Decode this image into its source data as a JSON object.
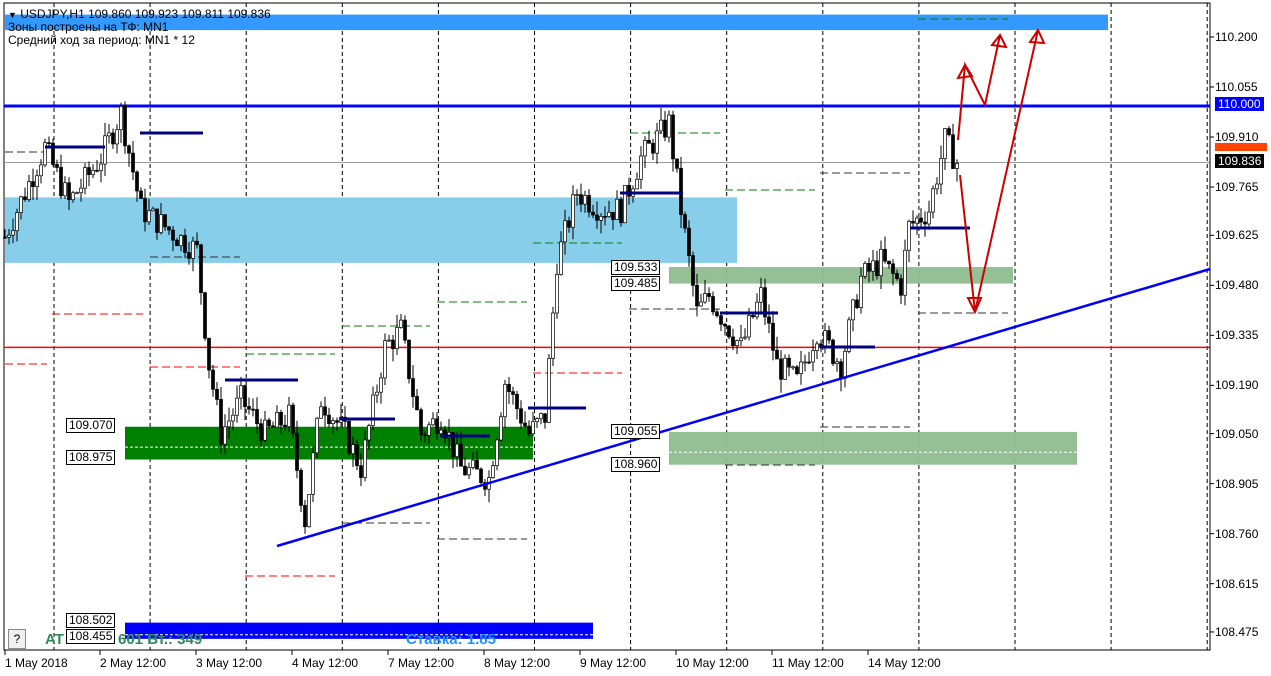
{
  "header": {
    "title": "USDJPY,H1  109.860 109.923 109.811 109.836",
    "line2": "Зоны построены на ТФ: MN1",
    "line3": "Средний ход за период: MN1 * 12"
  },
  "info": {
    "left_a": "AT",
    "left_b": "601  Вт.: 349",
    "rate": "Ставка: 1.85",
    "help": "?"
  },
  "colors": {
    "up_line": "#0000ff",
    "red_line": "#ff0000",
    "zone_light_blue": "#87ceeb",
    "zone_green": "#008000",
    "zone_light_green": "#8fbc8f",
    "zone_blue": "#0000ff",
    "top_band": "#3399ff",
    "arrows": "#cc0000"
  },
  "chart_data": {
    "type": "candlestick",
    "symbol": "USDJPY",
    "timeframe": "H1",
    "ylim": [
      108.42,
      110.3
    ],
    "y_ticks": [
      "110.200",
      "110.055",
      "109.910",
      "109.765",
      "109.625",
      "109.480",
      "109.335",
      "109.190",
      "109.050",
      "108.905",
      "108.760",
      "108.615",
      "108.475"
    ],
    "x_ticks": [
      "1 May 2018",
      "2 May 12:00",
      "3 May 12:00",
      "4 May 12:00",
      "7 May 12:00",
      "8 May 12:00",
      "9 May 12:00",
      "10 May 12:00",
      "11 May 12:00",
      "14 May 12:00"
    ],
    "price_path": [
      [
        "1 May 12:00",
        109.62
      ],
      [
        "1 May 22:00",
        109.88
      ],
      [
        "2 May 04:00",
        109.72
      ],
      [
        "2 May 12:00",
        109.85
      ],
      [
        "2 May 17:00",
        109.98
      ],
      [
        "2 May 22:00",
        109.7
      ],
      [
        "3 May 04:00",
        109.65
      ],
      [
        "3 May 12:00",
        109.58
      ],
      [
        "3 May 15:00",
        109.25
      ],
      [
        "3 May 18:00",
        109.05
      ],
      [
        "3 May 23:00",
        109.15
      ],
      [
        "4 May 05:00",
        109.05
      ],
      [
        "4 May 11:00",
        109.1
      ],
      [
        "4 May 15:00",
        108.8
      ],
      [
        "4 May 19:00",
        109.15
      ],
      [
        "7 May 01:00",
        109.05
      ],
      [
        "7 May 05:00",
        108.95
      ],
      [
        "7 May 11:00",
        109.3
      ],
      [
        "7 May 15:00",
        109.35
      ],
      [
        "7 May 20:00",
        109.05
      ],
      [
        "8 May 01:00",
        109.1
      ],
      [
        "8 May 06:00",
        108.95
      ],
      [
        "8 May 13:00",
        108.92
      ],
      [
        "8 May 17:00",
        109.2
      ],
      [
        "8 May 23:00",
        109.05
      ],
      [
        "9 May 03:00",
        109.1
      ],
      [
        "9 May 06:00",
        109.55
      ],
      [
        "9 May 11:00",
        109.75
      ],
      [
        "9 May 17:00",
        109.7
      ],
      [
        "9 May 22:00",
        109.7
      ],
      [
        "10 May 03:00",
        109.85
      ],
      [
        "10 May 10:00",
        109.95
      ],
      [
        "10 May 13:00",
        109.7
      ],
      [
        "10 May 17:00",
        109.4
      ],
      [
        "10 May 20:00",
        109.45
      ],
      [
        "11 May 04:00",
        109.3
      ],
      [
        "11 May 09:00",
        109.45
      ],
      [
        "11 May 13:00",
        109.25
      ],
      [
        "11 May 18:00",
        109.2
      ],
      [
        "11 May 23:00",
        109.35
      ],
      [
        "14 May 05:00",
        109.25
      ],
      [
        "14 May 10:00",
        109.5
      ],
      [
        "14 May 15:00",
        109.55
      ],
      [
        "14 May 20:00",
        109.48
      ],
      [
        "14 May 22:00",
        109.65
      ],
      [
        "15 May 03:00",
        109.7
      ],
      [
        "15 May 07:00",
        109.9
      ],
      [
        "15 May 10:00",
        109.836
      ]
    ],
    "levels": {
      "blue": 110.0,
      "red": 109.3,
      "current": 109.836
    },
    "zones": [
      {
        "name": "top-band",
        "low": 110.22,
        "high": 110.265
      },
      {
        "name": "light-blue",
        "low": 109.545,
        "high": 109.735
      },
      {
        "name": "green-upper-right",
        "low": 109.485,
        "high": 109.533,
        "labels": [
          "109.533",
          "109.485"
        ]
      },
      {
        "name": "green-left",
        "low": 108.975,
        "high": 109.07,
        "labels": [
          "109.070",
          "108.975"
        ]
      },
      {
        "name": "green-lower-right",
        "low": 108.96,
        "high": 109.055,
        "labels": [
          "109.055",
          "108.960"
        ]
      },
      {
        "name": "blue-bottom",
        "low": 108.455,
        "high": 108.502,
        "labels": [
          "108.502",
          "108.455"
        ]
      }
    ],
    "price_labels": {
      "blue": "110.000",
      "current": "109.836"
    }
  }
}
